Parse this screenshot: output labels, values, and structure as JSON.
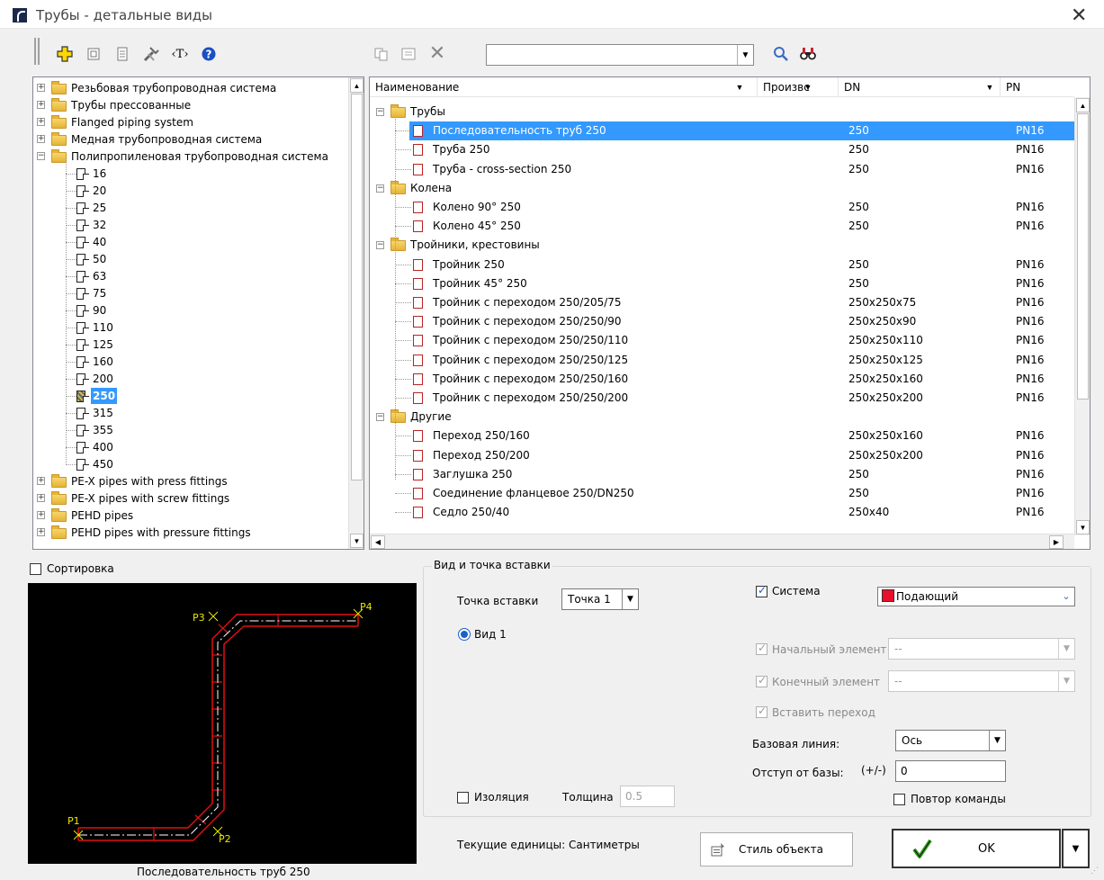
{
  "window": {
    "title": "Трубы - детальные виды",
    "close_glyph": "✕"
  },
  "toolbar": {
    "search_value": "",
    "icons": [
      "add-icon",
      "properties-icon",
      "list-icon",
      "tools-icon",
      "text-icon",
      "help-icon",
      "copy-icon",
      "details-icon",
      "delete-icon",
      "search-icon",
      "binoculars-icon"
    ]
  },
  "tree": {
    "items": [
      {
        "label": "Резьбовая трубопроводная система",
        "type": "folder"
      },
      {
        "label": "Трубы прессованные",
        "type": "folder"
      },
      {
        "label": "Flanged piping system",
        "type": "folder"
      },
      {
        "label": "Медная трубопроводная система",
        "type": "folder"
      },
      {
        "label": "Полипропиленовая трубопроводная система",
        "type": "folder-open"
      },
      {
        "label": "16",
        "type": "doc"
      },
      {
        "label": "20",
        "type": "doc"
      },
      {
        "label": "25",
        "type": "doc"
      },
      {
        "label": "32",
        "type": "doc"
      },
      {
        "label": "40",
        "type": "doc"
      },
      {
        "label": "50",
        "type": "doc"
      },
      {
        "label": "63",
        "type": "doc"
      },
      {
        "label": "75",
        "type": "doc"
      },
      {
        "label": "90",
        "type": "doc"
      },
      {
        "label": "110",
        "type": "doc"
      },
      {
        "label": "125",
        "type": "doc"
      },
      {
        "label": "160",
        "type": "doc"
      },
      {
        "label": "200",
        "type": "doc"
      },
      {
        "label": "250",
        "type": "doc-selected"
      },
      {
        "label": "315",
        "type": "doc"
      },
      {
        "label": "355",
        "type": "doc"
      },
      {
        "label": "400",
        "type": "doc"
      },
      {
        "label": "450",
        "type": "doc"
      },
      {
        "label": "PE-X pipes with press fittings",
        "type": "folder"
      },
      {
        "label": "PE-X pipes with screw fittings",
        "type": "folder"
      },
      {
        "label": "PEHD pipes",
        "type": "folder"
      },
      {
        "label": "PEHD pipes with pressure fittings",
        "type": "folder"
      }
    ]
  },
  "list": {
    "columns": [
      "Наименование",
      "Произвс",
      "DN",
      "PN"
    ],
    "rows": [
      {
        "kind": "group",
        "name": "Трубы"
      },
      {
        "kind": "item",
        "name": "Последовательность труб 250",
        "dn": "250",
        "pn": "PN16",
        "selected": true
      },
      {
        "kind": "item",
        "name": "Труба 250",
        "dn": "250",
        "pn": "PN16"
      },
      {
        "kind": "item",
        "name": "Труба - cross-section 250",
        "dn": "250",
        "pn": "PN16"
      },
      {
        "kind": "group",
        "name": "Колена"
      },
      {
        "kind": "item",
        "name": "Колено 90° 250",
        "dn": "250",
        "pn": "PN16"
      },
      {
        "kind": "item",
        "name": "Колено 45° 250",
        "dn": "250",
        "pn": "PN16"
      },
      {
        "kind": "group",
        "name": "Тройники, крестовины"
      },
      {
        "kind": "item",
        "name": "Тройник 250",
        "dn": "250",
        "pn": "PN16"
      },
      {
        "kind": "item",
        "name": "Тройник 45° 250",
        "dn": "250",
        "pn": "PN16"
      },
      {
        "kind": "item",
        "name": "Тройник с переходом 250/205/75",
        "dn": "250x250x75",
        "pn": "PN16"
      },
      {
        "kind": "item",
        "name": "Тройник с переходом 250/250/90",
        "dn": "250x250x90",
        "pn": "PN16"
      },
      {
        "kind": "item",
        "name": "Тройник с переходом 250/250/110",
        "dn": "250x250x110",
        "pn": "PN16"
      },
      {
        "kind": "item",
        "name": "Тройник с переходом 250/250/125",
        "dn": "250x250x125",
        "pn": "PN16"
      },
      {
        "kind": "item",
        "name": "Тройник с переходом 250/250/160",
        "dn": "250x250x160",
        "pn": "PN16"
      },
      {
        "kind": "item",
        "name": "Тройник с переходом 250/250/200",
        "dn": "250x250x200",
        "pn": "PN16"
      },
      {
        "kind": "group",
        "name": "Другие"
      },
      {
        "kind": "item",
        "name": "Переход 250/160",
        "dn": "250x250x160",
        "pn": "PN16"
      },
      {
        "kind": "item",
        "name": "Переход 250/200",
        "dn": "250x250x200",
        "pn": "PN16"
      },
      {
        "kind": "item",
        "name": "Заглушка 250",
        "dn": "250",
        "pn": "PN16"
      },
      {
        "kind": "item",
        "name": "Соединение фланцевое 250/DN250",
        "dn": "250",
        "pn": "PN16"
      },
      {
        "kind": "item",
        "name": "Седло 250/40",
        "dn": "250x40",
        "pn": "PN16"
      }
    ]
  },
  "bottom": {
    "sort_label": "Сортировка",
    "preview_caption": "Последовательность труб 250",
    "preview_points": [
      "P1",
      "P2",
      "P3",
      "P4"
    ],
    "group_title": "Вид и точка вставки",
    "insert_point_label": "Точка вставки",
    "insert_point_value": "Точка 1",
    "view_label": "Вид 1",
    "system_label": "Система",
    "system_value": "Подающий",
    "system_color": "#e8102a",
    "start_element_label": "Начальный элемент",
    "start_element_value": "--",
    "end_element_label": "Конечный элемент",
    "end_element_value": "--",
    "insert_transition_label": "Вставить переход",
    "base_line_label": "Базовая линия:",
    "base_line_value": "Ось",
    "offset_label": "Отступ от базы:",
    "offset_sign": "(+/-)",
    "offset_value": "0",
    "repeat_label": "Повтор команды",
    "insulation_label": "Изоляция",
    "thickness_label": "Толщина",
    "thickness_value": "0.5",
    "units_text": "Текущие единицы: Сантиметры",
    "style_button": "Стиль объекта",
    "ok_button": "OK"
  }
}
